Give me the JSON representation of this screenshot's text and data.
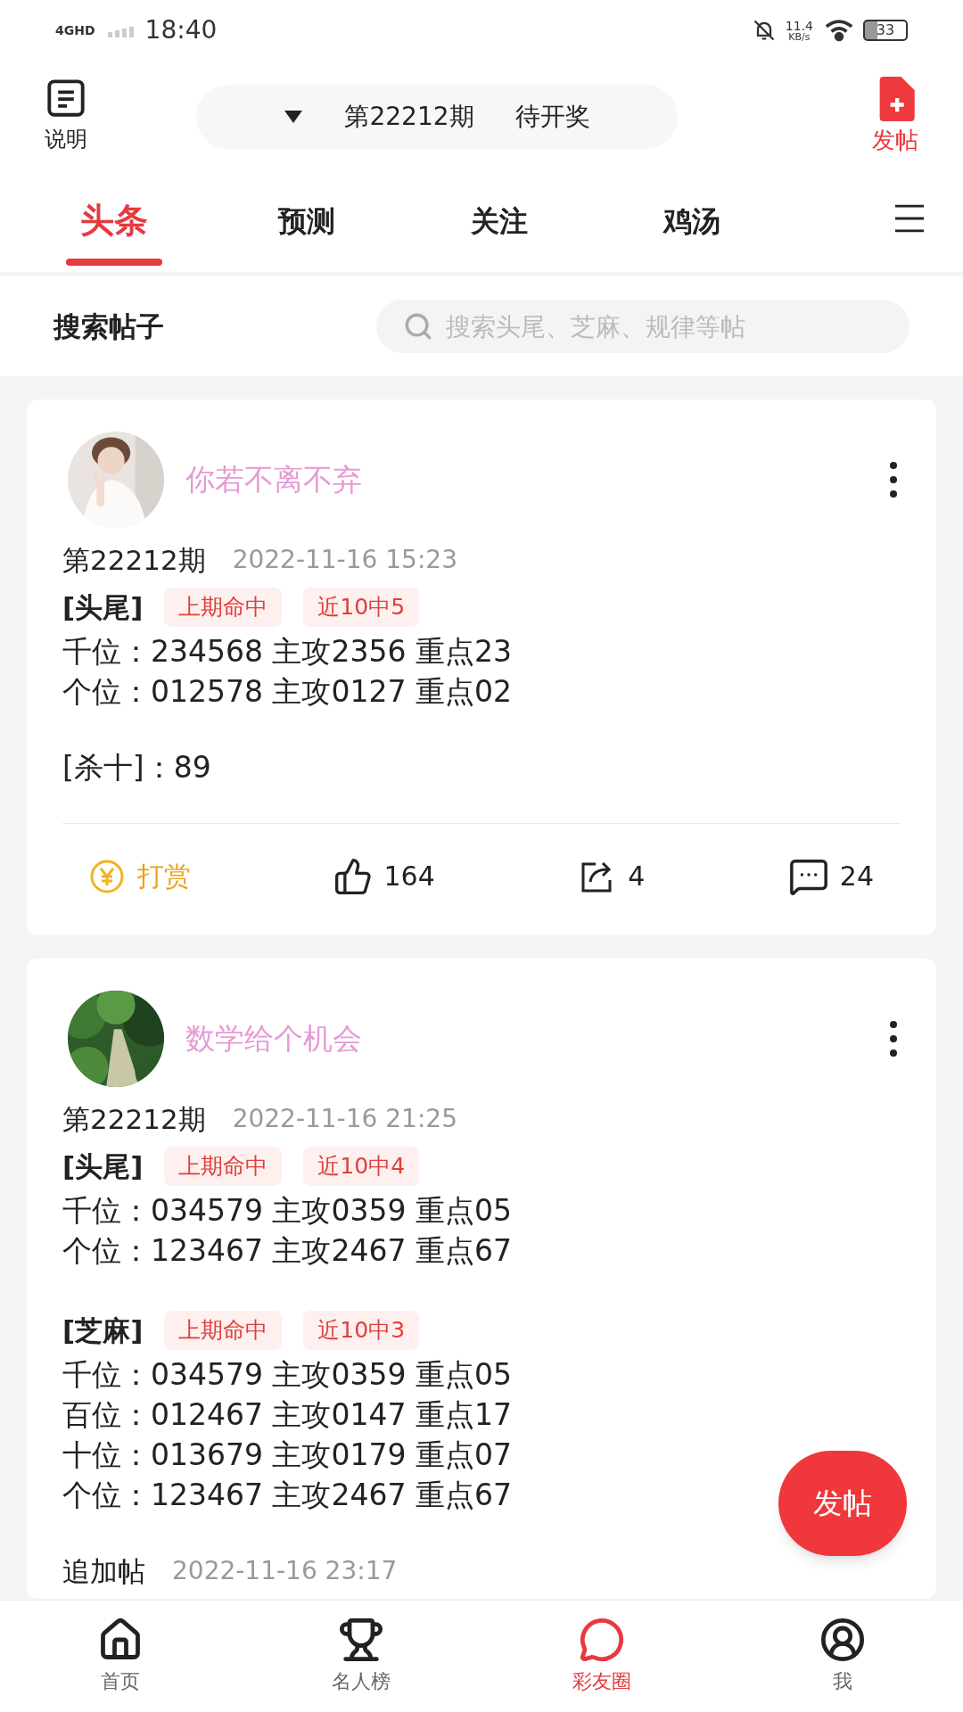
{
  "status_bar": {
    "network": "4GHD",
    "time": "18:40",
    "speed": "11.4",
    "speed_unit": "KB/s",
    "battery": "33"
  },
  "header": {
    "left_button": "说明",
    "period_selector": {
      "period": "第22212期",
      "status": "待开奖"
    },
    "right_button": "发帖"
  },
  "tabs": [
    {
      "label": "头条",
      "selected": true
    },
    {
      "label": "预测",
      "selected": false
    },
    {
      "label": "关注",
      "selected": false
    },
    {
      "label": "鸡汤",
      "selected": false
    }
  ],
  "search": {
    "label": "搜索帖子",
    "placeholder": "搜索头尾、芝麻、规律等帖"
  },
  "posts": [
    {
      "author": "你若不离不弃",
      "period": "第22212期",
      "time": "2022-11-16 15:23",
      "sections": [
        {
          "kind": "block",
          "title": "[头尾]",
          "tags": [
            "上期命中",
            "近10中5"
          ],
          "lines": [
            "千位：234568 主攻2356 重点23",
            "个位：012578 主攻0127 重点02"
          ]
        },
        {
          "kind": "line",
          "text": "[杀十]：89"
        }
      ],
      "actions": {
        "reward": "打赏",
        "likes": "164",
        "shares": "4",
        "comments": "24"
      }
    },
    {
      "author": "数学给个机会",
      "period": "第22212期",
      "time": "2022-11-16 21:25",
      "sections": [
        {
          "kind": "block",
          "title": "[头尾]",
          "tags": [
            "上期命中",
            "近10中4"
          ],
          "lines": [
            "千位：034579 主攻0359 重点05",
            "个位：123467 主攻2467 重点67"
          ]
        },
        {
          "kind": "block",
          "title": "[芝麻]",
          "tags": [
            "上期命中",
            "近10中3"
          ],
          "lines": [
            "千位：034579 主攻0359 重点05",
            "百位：012467 主攻0147 重点17",
            "十位：013679 主攻0179 重点07",
            "个位：123467 主攻2467 重点67"
          ]
        }
      ],
      "append": {
        "label": "追加帖",
        "time": "2022-11-16 23:17"
      }
    }
  ],
  "fab": "发帖",
  "bottom_nav": [
    {
      "label": "首页",
      "selected": false
    },
    {
      "label": "名人榜",
      "selected": false
    },
    {
      "label": "彩友圈",
      "selected": true
    },
    {
      "label": "我",
      "selected": false
    }
  ]
}
